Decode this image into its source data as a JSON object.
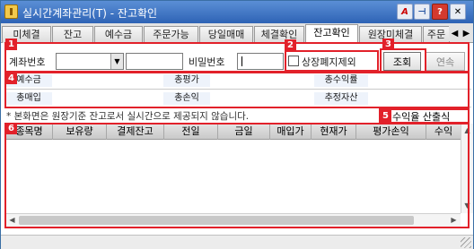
{
  "window": {
    "title": "실시간계좌관리(T) - 잔고확인",
    "buttons": {
      "font": "A",
      "pin": "⊣",
      "help": "?",
      "close": "✕"
    }
  },
  "tabs": [
    {
      "label": "미체결",
      "active": false
    },
    {
      "label": "잔고",
      "active": false
    },
    {
      "label": "예수금",
      "active": false
    },
    {
      "label": "주문가능",
      "active": false
    },
    {
      "label": "당일매매",
      "active": false
    },
    {
      "label": "체결확인",
      "active": false
    },
    {
      "label": "잔고확인",
      "active": true
    },
    {
      "label": "원장미체결",
      "active": false
    },
    {
      "label": "주문",
      "active": false
    }
  ],
  "tab_nav": {
    "prev": "◀",
    "next": "▶"
  },
  "markers": [
    "1",
    "2",
    "3",
    "4",
    "5",
    "6"
  ],
  "filter": {
    "account_label": "계좌번호",
    "account_value": "",
    "account_name_value": "",
    "password_label": "비밀번호",
    "password_value": "",
    "exclude_delisted_label": "상장폐지제외",
    "exclude_delisted_checked": false,
    "query_button": "조회",
    "continue_button": "연속"
  },
  "summary": {
    "row1": [
      {
        "label": "예수금",
        "value": ""
      },
      {
        "label": "총평가",
        "value": ""
      },
      {
        "label": "총수익률",
        "value": ""
      }
    ],
    "row2": [
      {
        "label": "총매입",
        "value": ""
      },
      {
        "label": "총손익",
        "value": ""
      },
      {
        "label": "추정자산",
        "value": ""
      }
    ]
  },
  "notice": "* 본화면은 원장기준 잔고로서 실시간으로 제공되지 않습니다.",
  "calc_button": "수익율 산출식",
  "table": {
    "columns": [
      "종목명",
      "보유량",
      "결제잔고",
      "전일",
      "금일",
      "매입가",
      "현재가",
      "평가손익",
      "수익"
    ],
    "rows": []
  },
  "colors": {
    "highlight": "#e2212a",
    "title_bar": "#2e63b5",
    "summary_header": "#eef3fb"
  }
}
